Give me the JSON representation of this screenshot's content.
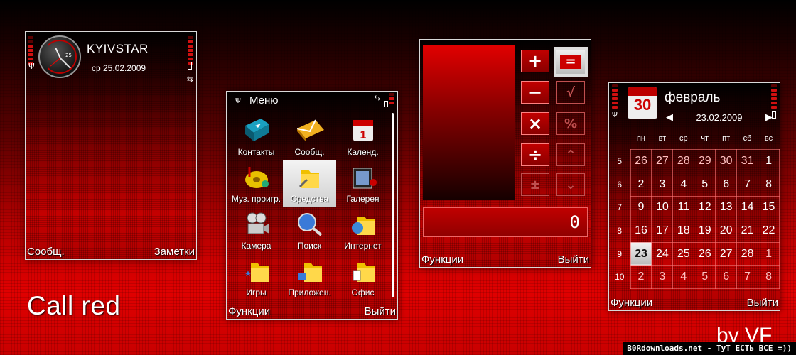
{
  "branding": {
    "title": "Call red",
    "author": "by VF",
    "watermark": "B0Rdownloads.net - ТуТ ЕСТЬ ВСЕ =))"
  },
  "standby": {
    "operator": "KYIVSTAR",
    "date": "ср 25.02.2009",
    "clock_face_number": "25",
    "left_soft": "Сообщ.",
    "right_soft": "Заметки"
  },
  "menu": {
    "title": "Меню",
    "items": [
      {
        "label": "Контакты",
        "icon": "contacts-icon"
      },
      {
        "label": "Сообщ.",
        "icon": "messages-icon"
      },
      {
        "label": "Календ.",
        "icon": "calendar-icon"
      },
      {
        "label": "Муз. проигр.",
        "icon": "music-player-icon"
      },
      {
        "label": "Средства",
        "icon": "tools-folder-icon",
        "selected": true
      },
      {
        "label": "Галерея",
        "icon": "gallery-icon"
      },
      {
        "label": "Камера",
        "icon": "camera-icon"
      },
      {
        "label": "Поиск",
        "icon": "search-icon"
      },
      {
        "label": "Интернет",
        "icon": "internet-icon"
      },
      {
        "label": "Игры",
        "icon": "games-folder-icon"
      },
      {
        "label": "Приложен.",
        "icon": "apps-folder-icon"
      },
      {
        "label": "Офис",
        "icon": "office-folder-icon"
      }
    ],
    "left_soft": "Функции",
    "right_soft": "Выйти"
  },
  "calculator": {
    "result": "0",
    "keys": [
      "+",
      "=",
      "−",
      "√",
      "×",
      "%",
      "÷",
      "⌃",
      "±",
      "⌄"
    ],
    "left_soft": "Функции",
    "right_soft": "Выйти"
  },
  "calendar": {
    "icon_day": "30",
    "month": "февраль",
    "date": "23.02.2009",
    "weekdays": [
      "пн",
      "вт",
      "ср",
      "чт",
      "пт",
      "сб",
      "вс"
    ],
    "weeks": [
      {
        "num": "5",
        "days": [
          "26",
          "27",
          "28",
          "29",
          "30",
          "31",
          "1"
        ]
      },
      {
        "num": "6",
        "days": [
          "2",
          "3",
          "4",
          "5",
          "6",
          "7",
          "8"
        ]
      },
      {
        "num": "7",
        "days": [
          "9",
          "10",
          "11",
          "12",
          "13",
          "14",
          "15"
        ]
      },
      {
        "num": "8",
        "days": [
          "16",
          "17",
          "18",
          "19",
          "20",
          "21",
          "22"
        ]
      },
      {
        "num": "9",
        "days": [
          "23",
          "24",
          "25",
          "26",
          "27",
          "28",
          "1"
        ]
      },
      {
        "num": "10",
        "days": [
          "2",
          "3",
          "4",
          "5",
          "6",
          "7",
          "8"
        ]
      }
    ],
    "left_soft": "Функции",
    "right_soft": "Выйти"
  },
  "colors": {
    "accent": "#cc0000",
    "highlight": "#e8e8e8"
  }
}
